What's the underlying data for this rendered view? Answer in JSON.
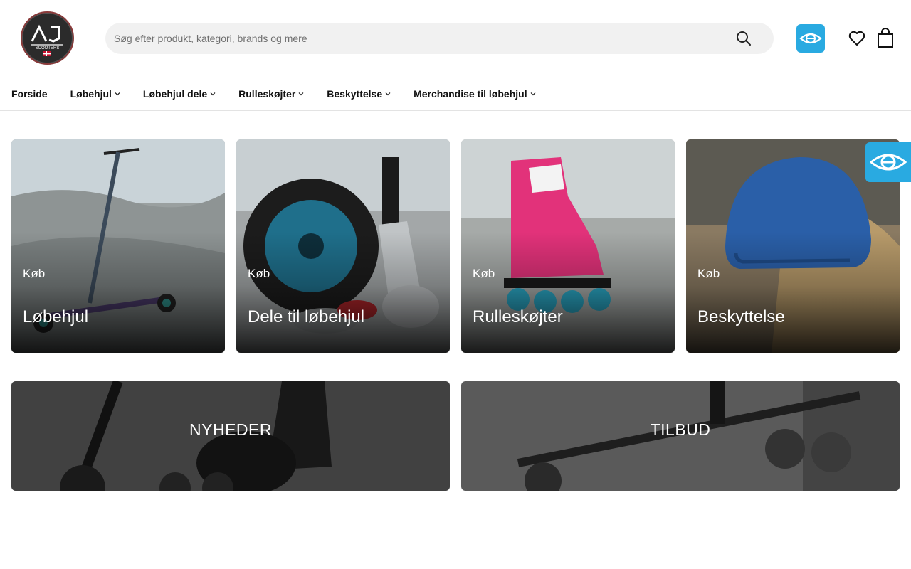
{
  "header": {
    "logo_text": "AJ",
    "logo_subtext": "SCOOTERS",
    "search": {
      "placeholder": "Søg efter produkt, kategori, brands og mere",
      "value": ""
    }
  },
  "nav": {
    "items": [
      {
        "label": "Forside",
        "has_dropdown": false
      },
      {
        "label": "Løbehjul",
        "has_dropdown": true
      },
      {
        "label": "Løbehjul dele",
        "has_dropdown": true
      },
      {
        "label": "Rulleskøjter",
        "has_dropdown": true
      },
      {
        "label": "Beskyttelse",
        "has_dropdown": true
      },
      {
        "label": "Merchandise til løbehjul",
        "has_dropdown": true
      }
    ]
  },
  "categories": [
    {
      "kicker": "Køb",
      "title": "Løbehjul"
    },
    {
      "kicker": "Køb",
      "title": "Dele til løbehjul"
    },
    {
      "kicker": "Køb",
      "title": "Rulleskøjter"
    },
    {
      "kicker": "Køb",
      "title": "Beskyttelse"
    }
  ],
  "banners": [
    {
      "label": "NYHEDER"
    },
    {
      "label": "TILBUD"
    }
  ],
  "colors": {
    "accent_badge": "#29aae1",
    "search_bg": "#f1f1f1",
    "nav_text": "#111111"
  },
  "icons": {
    "search": "search-icon",
    "wishlist": "heart-icon",
    "cart": "shopping-bag-icon",
    "badge": "e-maerket-icon",
    "dropdown": "chevron-down-icon"
  }
}
